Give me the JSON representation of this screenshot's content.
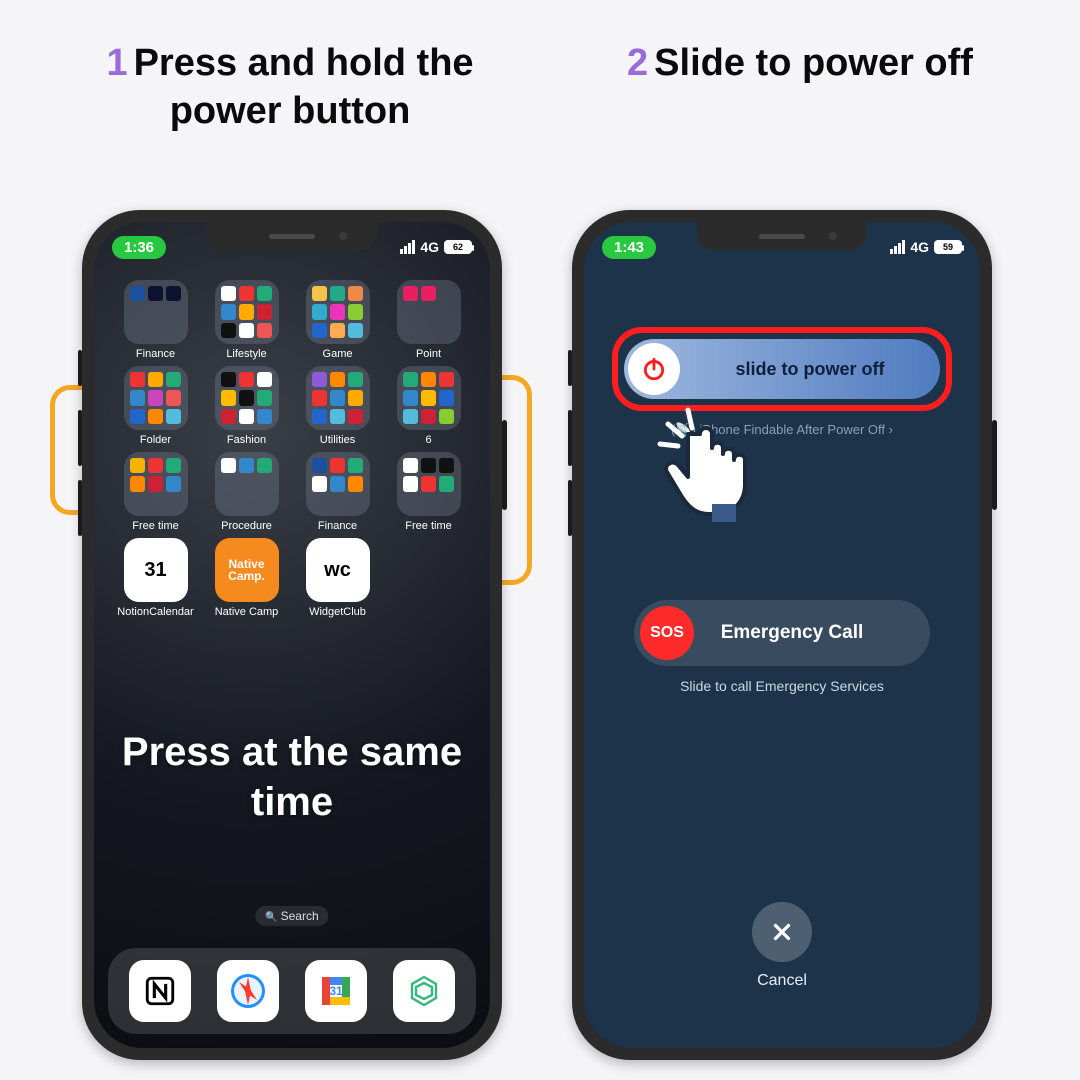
{
  "steps": {
    "s1": {
      "num": "1",
      "title": "Press and hold the power button"
    },
    "s2": {
      "num": "2",
      "title": "Slide to power off"
    }
  },
  "phone1": {
    "status": {
      "time": "1:36",
      "net": "4G",
      "batt": "62"
    },
    "folders": [
      {
        "label": "Finance",
        "c": [
          "#1b4fa0",
          "#0c1330",
          "#0c1330"
        ]
      },
      {
        "label": "Lifestyle",
        "c": [
          "#fff",
          "#e33",
          "#2a7",
          "#38c",
          "#fa0",
          "#c23",
          "#111",
          "#fff",
          "#e55"
        ]
      },
      {
        "label": "Game",
        "c": [
          "#f4c34a",
          "#2a8",
          "#e84",
          "#3ac",
          "#e3b",
          "#8c3",
          "#26c",
          "#fa5",
          "#5bd"
        ]
      },
      {
        "label": "Point",
        "c": [
          "#e91e63",
          "#e91e63"
        ]
      },
      {
        "label": "Folder",
        "c": [
          "#e33",
          "#fa0",
          "#2a7",
          "#38c",
          "#c4b",
          "#e55",
          "#26c",
          "#f80",
          "#5bd"
        ]
      },
      {
        "label": "Fashion",
        "c": [
          "#111",
          "#e33",
          "#fff",
          "#fb0",
          "#111",
          "#2a7",
          "#c23",
          "#fff",
          "#38c"
        ]
      },
      {
        "label": "Utilities",
        "c": [
          "#8c5bd6",
          "#f80",
          "#2a7",
          "#e33",
          "#38c",
          "#fa0",
          "#26c",
          "#5bd",
          "#c23"
        ]
      },
      {
        "label": "6",
        "c": [
          "#2a7",
          "#f80",
          "#e33",
          "#38c",
          "#fb0",
          "#26c",
          "#5bd",
          "#c23",
          "#8c3"
        ]
      },
      {
        "label": "Free time",
        "c": [
          "#f4b400",
          "#e33",
          "#2a7",
          "#f80",
          "#c23",
          "#38c"
        ]
      },
      {
        "label": "Procedure",
        "c": [
          "#fff",
          "#38c",
          "#2a7"
        ]
      },
      {
        "label": "Finance",
        "c": [
          "#1b4fa0",
          "#e33",
          "#2a7",
          "#fff",
          "#38c",
          "#f80"
        ]
      },
      {
        "label": "Free time",
        "c": [
          "#fff",
          "#111",
          "#111",
          "#fff",
          "#e33",
          "#2a7"
        ]
      }
    ],
    "apps": [
      {
        "label": "NotionCalendar",
        "bg": "#ffffff",
        "glyph": "31",
        "fg": "#000"
      },
      {
        "label": "Native Camp",
        "bg": "#f58a1f",
        "glyph": "Native\nCamp.",
        "fg": "#fff"
      },
      {
        "label": "WidgetClub",
        "bg": "#ffffff",
        "glyph": "wc",
        "fg": "#000"
      }
    ],
    "overlay": "Press at the same time",
    "search": "Search",
    "dock": [
      {
        "name": "notion",
        "bg": "#fff"
      },
      {
        "name": "safari",
        "bg": "#fff"
      },
      {
        "name": "gcal",
        "bg": "#fff"
      },
      {
        "name": "chatgpt",
        "bg": "#fff"
      }
    ]
  },
  "phone2": {
    "status": {
      "time": "1:43",
      "net": "4G",
      "batt": "59"
    },
    "slider": {
      "text": "slide to power off"
    },
    "findable": "iPhone Findable After Power Off",
    "sos": {
      "badge": "SOS",
      "label": "Emergency Call",
      "sub": "Slide to call Emergency Services"
    },
    "cancel": "Cancel"
  },
  "colors": {
    "accent": "#f5a623",
    "step": "#9a6bd9",
    "danger": "#ff1d1d"
  }
}
